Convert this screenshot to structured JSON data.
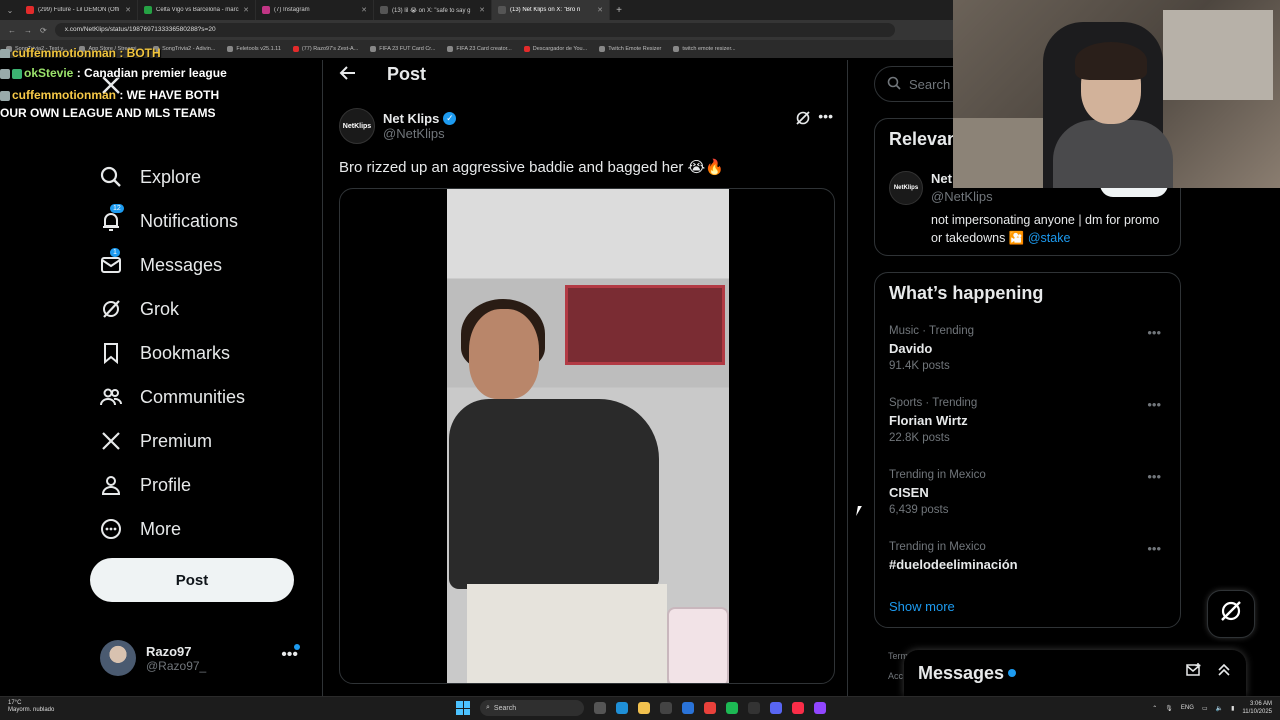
{
  "browser": {
    "tabs": [
      {
        "title": "(299) Future - Lil DEMON (Offi",
        "color": "#e32b2b"
      },
      {
        "title": "Celta Vigo vs Barcelona - marc",
        "color": "#25a244"
      },
      {
        "title": "(7) Instagram",
        "color": "#c13584"
      },
      {
        "title": "(13) lil 😭 on X: \"safe to say g",
        "color": "#e7e9ea"
      },
      {
        "title": "(13) Net Klips on X: \"Bro ri",
        "color": "#e7e9ea"
      }
    ],
    "url": "x.com/NetKlips/status/1987697133336580288?s=20",
    "bookmarks": [
      "SongTrivia2 - Test y...",
      "App Store / Streami...",
      "SongTrivia2 - Adivin...",
      "Feletools v25.1.11",
      "(77) Razo97's Zest-A...",
      "FIFA 23 FUT Card Cr...",
      "FIFA 23 Card creator...",
      "Descargador de You...",
      "Twitch Emote Resizer",
      "twitch emote resizer..."
    ]
  },
  "chat": {
    "top_partial": "cuffemmotionman : BOTH",
    "line1_user": "okStevie",
    "line1_text": " : Canadian premier league",
    "line2_user": "cuffemmotionman",
    "line2_text": " : WE HAVE BOTH OUR OWN LEAGUE AND MLS TEAMS"
  },
  "nav": {
    "items": [
      {
        "label": "Explore",
        "icon": "search-icon",
        "badge": ""
      },
      {
        "label": "Notifications",
        "icon": "bell-icon",
        "badge": "12"
      },
      {
        "label": "Messages",
        "icon": "envelope-icon",
        "badge": "1"
      },
      {
        "label": "Grok",
        "icon": "grok-icon",
        "badge": ""
      },
      {
        "label": "Bookmarks",
        "icon": "bookmark-icon",
        "badge": ""
      },
      {
        "label": "Communities",
        "icon": "people-icon",
        "badge": ""
      },
      {
        "label": "Premium",
        "icon": "x-logo-icon",
        "badge": ""
      },
      {
        "label": "Profile",
        "icon": "person-icon",
        "badge": ""
      },
      {
        "label": "More",
        "icon": "more-circle-icon",
        "badge": ""
      }
    ],
    "post_button": "Post",
    "account": {
      "name": "Razo97",
      "handle": "@Razo97_"
    }
  },
  "post": {
    "header": "Post",
    "author_name": "Net Klips",
    "author_handle": "@NetKlips",
    "avatar_text": "NetKlips",
    "text": "Bro rizzed up an aggressive baddie and bagged her 😭🔥"
  },
  "sidebar": {
    "search_placeholder": "Search",
    "relevant": {
      "title": "Relevant people",
      "name": "Net Klips",
      "handle": "@NetKlips",
      "follow": "Follow",
      "bio": "not impersonating anyone | dm for promo or takedowns 🎦 ",
      "bio_link": "@stake"
    },
    "happening": {
      "title": "What’s happening",
      "trends": [
        {
          "context": "Music · Trending",
          "name": "Davido",
          "count": "91.4K posts"
        },
        {
          "context": "Sports · Trending",
          "name": "Florian Wirtz",
          "count": "22.8K posts"
        },
        {
          "context": "Trending in Mexico",
          "name": "CISEN",
          "count": "6,439 posts"
        },
        {
          "context": "Trending in Mexico",
          "name": "#duelodeeliminación",
          "count": ""
        }
      ],
      "show_more": "Show more"
    },
    "footer_peek": [
      "Term",
      "Acc"
    ]
  },
  "messages_drawer": {
    "title": "Messages"
  },
  "taskbar": {
    "weather_temp": "17°C",
    "weather_desc": "Mayorm. nublado",
    "search": "Search",
    "lang": "ENG",
    "time": "3:06 AM",
    "date": "11/10/2025"
  }
}
